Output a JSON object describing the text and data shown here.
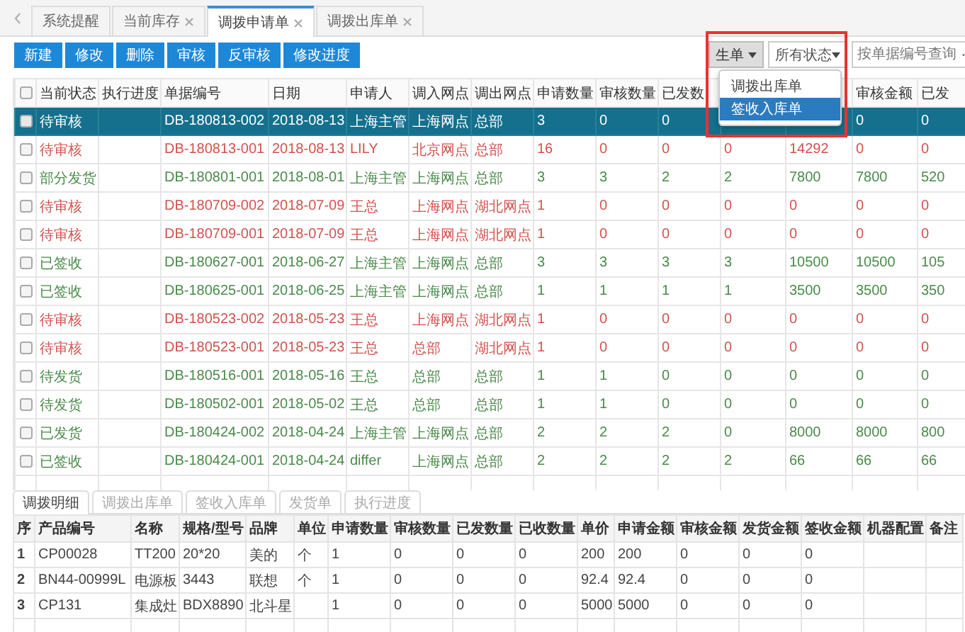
{
  "nav_tabs": [
    {
      "label": "系统提醒",
      "closable": false,
      "selected": false
    },
    {
      "label": "当前库存",
      "closable": true,
      "selected": false
    },
    {
      "label": "调拨申请单",
      "closable": true,
      "selected": true
    },
    {
      "label": "调拨出库单",
      "closable": true,
      "selected": false
    }
  ],
  "toolbar": {
    "buttons": [
      "新建",
      "修改",
      "删除",
      "审核",
      "反审核",
      "修改进度"
    ]
  },
  "filters": {
    "generate_button": "生单",
    "status_select": {
      "value": "所有状态"
    },
    "search_field": {
      "placeholder": "按单据编号查询"
    }
  },
  "dropdown_menu": {
    "items": [
      {
        "label": "调拨出库单",
        "selected": false
      },
      {
        "label": "签收入库单",
        "selected": true
      }
    ]
  },
  "annotation": {
    "kind": "frame",
    "color": "#e8332f"
  },
  "table": {
    "select_all": {
      "checked": false
    },
    "columns": [
      "当前状态",
      "执行进度",
      "单据编号",
      "日期",
      "申请人",
      "调入网点",
      "调出网点",
      "申请数量",
      "审核数量",
      "已发数",
      null,
      null,
      "审核金额",
      "已发"
    ],
    "rows": [
      {
        "selected": true,
        "checked": false,
        "color": "#ffffff",
        "cells": [
          "待审核",
          "",
          "DB-180813-002",
          "2018-08-13",
          "上海主管",
          "上海网点",
          "总部",
          "3",
          "0",
          "0",
          null,
          null,
          "0",
          "0"
        ]
      },
      {
        "selected": false,
        "checked": false,
        "color": "#d2524e",
        "cells": [
          "待审核",
          "",
          "DB-180813-001",
          "2018-08-13",
          "LILY",
          "北京网点",
          "总部",
          "16",
          "0",
          "0",
          "0",
          "14292",
          "0",
          "0"
        ]
      },
      {
        "selected": false,
        "checked": false,
        "color": "#4a8a4a",
        "cells": [
          "部分发货",
          "",
          "DB-180801-001",
          "2018-08-01",
          "上海主管",
          "上海网点",
          "总部",
          "3",
          "3",
          "2",
          "2",
          "7800",
          "7800",
          "520"
        ]
      },
      {
        "selected": false,
        "checked": false,
        "color": "#d2524e",
        "cells": [
          "待审核",
          "",
          "DB-180709-002",
          "2018-07-09",
          "王总",
          "上海网点",
          "湖北网点",
          "1",
          "0",
          "0",
          "0",
          "0",
          "0",
          "0"
        ]
      },
      {
        "selected": false,
        "checked": false,
        "color": "#d2524e",
        "cells": [
          "待审核",
          "",
          "DB-180709-001",
          "2018-07-09",
          "王总",
          "上海网点",
          "湖北网点",
          "1",
          "0",
          "0",
          "0",
          "0",
          "0",
          "0"
        ]
      },
      {
        "selected": false,
        "checked": false,
        "color": "#4a8a4a",
        "cells": [
          "已签收",
          "",
          "DB-180627-001",
          "2018-06-27",
          "上海主管",
          "上海网点",
          "总部",
          "3",
          "3",
          "3",
          "3",
          "10500",
          "10500",
          "105"
        ]
      },
      {
        "selected": false,
        "checked": false,
        "color": "#4a8a4a",
        "cells": [
          "已签收",
          "",
          "DB-180625-001",
          "2018-06-25",
          "上海主管",
          "上海网点",
          "总部",
          "1",
          "1",
          "1",
          "1",
          "3500",
          "3500",
          "350"
        ]
      },
      {
        "selected": false,
        "checked": false,
        "color": "#d2524e",
        "cells": [
          "待审核",
          "",
          "DB-180523-002",
          "2018-05-23",
          "王总",
          "上海网点",
          "湖北网点",
          "1",
          "0",
          "0",
          "0",
          "0",
          "0",
          "0"
        ]
      },
      {
        "selected": false,
        "checked": false,
        "color": "#d2524e",
        "cells": [
          "待审核",
          "",
          "DB-180523-001",
          "2018-05-23",
          "王总",
          "总部",
          "湖北网点",
          "1",
          "0",
          "0",
          "0",
          "0",
          "0",
          "0"
        ]
      },
      {
        "selected": false,
        "checked": false,
        "color": "#4a8a4a",
        "cells": [
          "待发货",
          "",
          "DB-180516-001",
          "2018-05-16",
          "王总",
          "总部",
          "总部",
          "1",
          "1",
          "0",
          "0",
          "0",
          "0",
          "0"
        ]
      },
      {
        "selected": false,
        "checked": false,
        "color": "#4a8a4a",
        "cells": [
          "待发货",
          "",
          "DB-180502-001",
          "2018-05-02",
          "王总",
          "总部",
          "总部",
          "1",
          "1",
          "0",
          "0",
          "0",
          "0",
          "0"
        ]
      },
      {
        "selected": false,
        "checked": false,
        "color": "#4a8a4a",
        "cells": [
          "已发货",
          "",
          "DB-180424-002",
          "2018-04-24",
          "上海主管",
          "上海网点",
          "总部",
          "2",
          "2",
          "2",
          "0",
          "8000",
          "8000",
          "800"
        ]
      },
      {
        "selected": false,
        "checked": false,
        "color": "#4a8a4a",
        "cells": [
          "已签收",
          "",
          "DB-180424-001",
          "2018-04-24",
          "differ",
          "上海网点",
          "总部",
          "2",
          "2",
          "2",
          "2",
          "66",
          "66",
          "66"
        ]
      }
    ]
  },
  "detail_panel": {
    "tabs": [
      {
        "label": "调拨明细",
        "selected": true
      },
      {
        "label": "调拨出库单",
        "selected": false
      },
      {
        "label": "签收入库单",
        "selected": false
      },
      {
        "label": "发货单",
        "selected": false
      },
      {
        "label": "执行进度",
        "selected": false
      }
    ],
    "columns": [
      "序",
      "产品编号",
      "名称",
      "规格/型号",
      "品牌",
      "单位",
      "申请数量",
      "审核数量",
      "已发数量",
      "已收数量",
      "单价",
      "申请金额",
      "审核金额",
      "发货金额",
      "签收金额",
      "机器配置",
      "备注"
    ],
    "rows": [
      {
        "cells": [
          "1",
          "CP00028",
          "TT200",
          "20*20",
          "美的",
          "个",
          "1",
          "0",
          "0",
          "0",
          "200",
          "200",
          "0",
          "0",
          "0",
          "",
          ""
        ]
      },
      {
        "cells": [
          "2",
          "BN44-00999L",
          "电源板",
          "3443",
          "联想",
          "个",
          "1",
          "0",
          "0",
          "0",
          "92.4",
          "92.4",
          "0",
          "0",
          "0",
          "",
          ""
        ]
      },
      {
        "cells": [
          "3",
          "CP131",
          "集成灶",
          "BDX8890",
          "北斗星",
          "",
          "1",
          "0",
          "0",
          "0",
          "5000",
          "5000",
          "0",
          "0",
          "0",
          "",
          ""
        ]
      }
    ]
  }
}
